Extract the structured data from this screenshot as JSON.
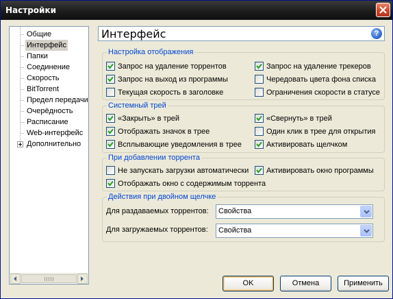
{
  "window": {
    "title": "Настройки"
  },
  "tree": {
    "items": [
      {
        "label": "Общие"
      },
      {
        "label": "Интерфейс",
        "selected": true
      },
      {
        "label": "Папки"
      },
      {
        "label": "Соединение"
      },
      {
        "label": "Скорость"
      },
      {
        "label": "BitTorrent"
      },
      {
        "label": "Предел передачи"
      },
      {
        "label": "Очерёдность"
      },
      {
        "label": "Расписание"
      },
      {
        "label": "Web-интерфейс"
      },
      {
        "label": "Дополнительно",
        "expandable": true
      }
    ]
  },
  "panel": {
    "title": "Интерфейс",
    "help_icon": "help-icon"
  },
  "display_group": {
    "title": "Настройка отображения",
    "options": [
      {
        "label": "Запрос на удаление торрентов",
        "checked": true
      },
      {
        "label": "Запрос на удаление трекеров",
        "checked": true
      },
      {
        "label": "Запрос на выход из программы",
        "checked": true
      },
      {
        "label": "Чередовать цвета фона списка",
        "checked": false
      },
      {
        "label": "Текущая скорость в заголовке",
        "checked": false
      },
      {
        "label": "Ограничения скорости в статусе",
        "checked": false
      }
    ]
  },
  "tray_group": {
    "title": "Системный трей",
    "options": [
      {
        "label": "«Закрыть» в трей",
        "checked": true
      },
      {
        "label": "«Свернуть» в трей",
        "checked": true
      },
      {
        "label": "Отображать значок в трее",
        "checked": true
      },
      {
        "label": "Один клик в трее для открытия",
        "checked": false
      },
      {
        "label": "Всплывающие уведомления в трее",
        "checked": true
      },
      {
        "label": "Активировать щелчком",
        "checked": true
      }
    ]
  },
  "add_group": {
    "title": "При добавлении торрента",
    "options": [
      {
        "label": "Не запускать загрузки автоматически",
        "checked": false
      },
      {
        "label": "Активировать окно программы",
        "checked": true
      },
      {
        "label": "Отображать окно с содержимым торрента",
        "checked": true
      }
    ]
  },
  "dblclick_group": {
    "title": "Действия при двойном щелчке",
    "seeding_label": "Для раздаваемых торрентов:",
    "seeding_value": "Свойства",
    "downloading_label": "Для загружаемых торрентов:",
    "downloading_value": "Свойства"
  },
  "buttons": {
    "ok": "OK",
    "cancel": "Отмена",
    "apply": "Применить"
  }
}
